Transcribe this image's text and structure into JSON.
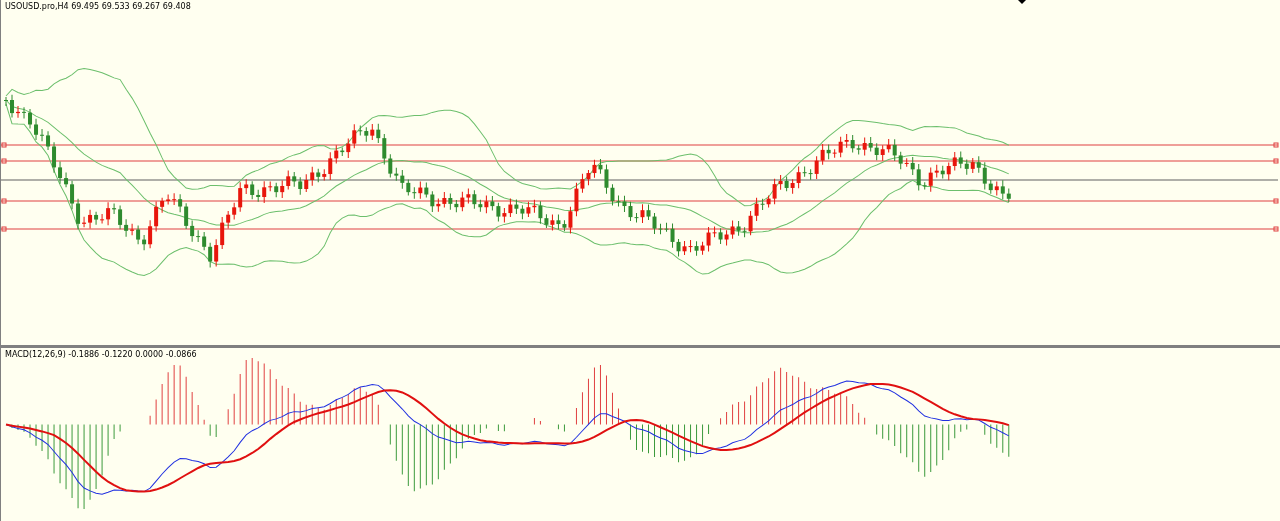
{
  "price_panel": {
    "label": "USOUSD.pro,H4  69.495 69.533 69.267 69.408"
  },
  "macd_panel": {
    "label": "MACD(12,26,9) -0.1886 -0.1220 0.0000 -0.0866"
  }
}
